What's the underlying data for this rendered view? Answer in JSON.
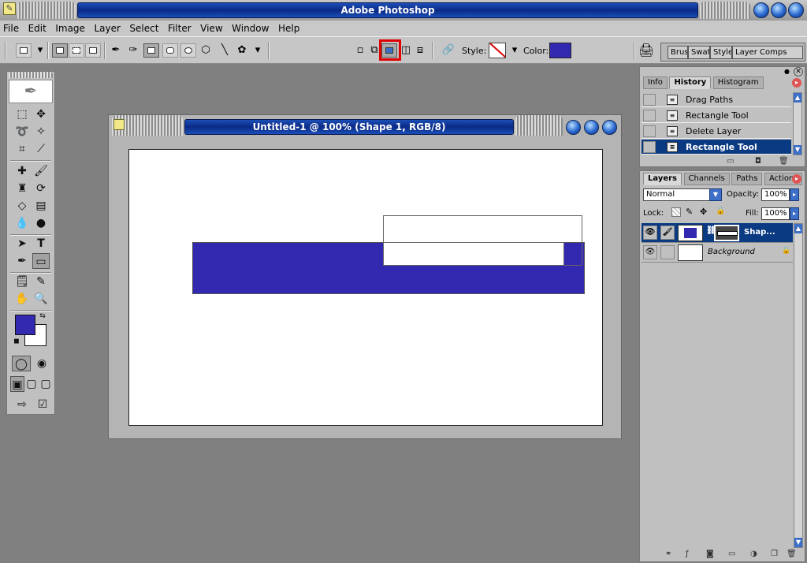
{
  "app": {
    "title": "Adobe Photoshop"
  },
  "menu": [
    "File",
    "Edit",
    "Image",
    "Layer",
    "Select",
    "Filter",
    "View",
    "Window",
    "Help"
  ],
  "options": {
    "style_label": "Style:",
    "color_label": "Color:",
    "color_value": "#3329b0",
    "palette_well": [
      "Brus",
      "Swat",
      "Style",
      "Layer Comps"
    ]
  },
  "colors": {
    "foreground": "#3329b0",
    "background": "#ffffff",
    "highlight": "#e00000"
  },
  "document": {
    "title": "Untitled-1 @ 100% (Shape 1, RGB/8)"
  },
  "history": {
    "tabs": [
      "Info",
      "History",
      "Histogram"
    ],
    "items": [
      "Drag Paths",
      "Rectangle Tool",
      "Delete Layer",
      "Rectangle Tool"
    ]
  },
  "layers": {
    "tabs": [
      "Layers",
      "Channels",
      "Paths",
      "Actions"
    ],
    "blend_mode": "Normal",
    "opacity_label": "Opacity:",
    "opacity_value": "100%",
    "lock_label": "Lock:",
    "fill_label": "Fill:",
    "fill_value": "100%",
    "rows": [
      {
        "name": "Shap...",
        "selected": true
      },
      {
        "name": "Background",
        "selected": false
      }
    ]
  }
}
